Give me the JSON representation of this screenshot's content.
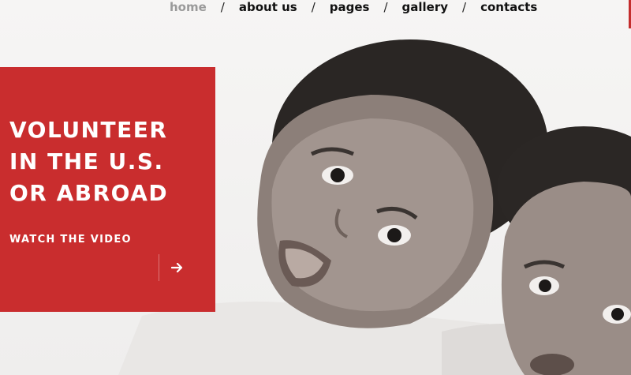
{
  "nav": {
    "items": [
      {
        "label": "home",
        "active": true
      },
      {
        "label": "about us",
        "active": false
      },
      {
        "label": "pages",
        "active": false
      },
      {
        "label": "gallery",
        "active": false
      },
      {
        "label": "contacts",
        "active": false
      }
    ],
    "separator": "/"
  },
  "hero": {
    "title_lines": [
      "VOLUNTEER",
      "IN THE U.S.",
      "OR ABROAD"
    ],
    "cta_label": "WATCH THE VIDEO",
    "cta_icon": "arrow-right-icon",
    "photo": "two-children-black-and-white-photo"
  },
  "colors": {
    "accent": "#c92d2e",
    "nav_text": "#111111",
    "nav_active": "#9a9a9a"
  }
}
